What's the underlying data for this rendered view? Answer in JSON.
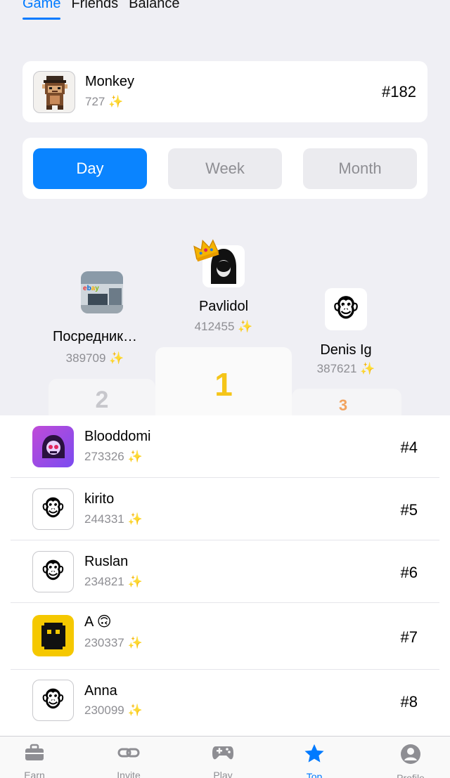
{
  "top_tabs": [
    {
      "label": "Game"
    },
    {
      "label": "Friends"
    },
    {
      "label": "Balance"
    }
  ],
  "me": {
    "name": "Monkey",
    "score": "727",
    "rank": "#182"
  },
  "periods": [
    {
      "label": "Day"
    },
    {
      "label": "Week"
    },
    {
      "label": "Month"
    }
  ],
  "sparkle": "✨",
  "podium": {
    "first": {
      "name": "Pavlidol",
      "score": "412455",
      "place": "1"
    },
    "second": {
      "name": "Посредник…",
      "score": "389709",
      "place": "2"
    },
    "third": {
      "name": "Denis Ig",
      "score": "387621",
      "place": "3"
    }
  },
  "list": [
    {
      "name": "Blooddomi",
      "score": "273326",
      "rank": "#4",
      "avatar": "purple-skull"
    },
    {
      "name": "kirito",
      "score": "244331",
      "rank": "#5",
      "avatar": "monkey-face"
    },
    {
      "name": "Ruslan",
      "score": "234821",
      "rank": "#6",
      "avatar": "monkey-face"
    },
    {
      "name": "A 🙃",
      "score": "230337",
      "rank": "#7",
      "avatar": "yellow-pixel"
    },
    {
      "name": "Anna",
      "score": "230099",
      "rank": "#8",
      "avatar": "monkey-face"
    }
  ],
  "emoji": {
    "monkey": "🐵"
  },
  "nav": [
    {
      "label": "Earn",
      "icon": "briefcase-icon"
    },
    {
      "label": "Invite",
      "icon": "link-icon"
    },
    {
      "label": "Play",
      "icon": "gamepad-icon"
    },
    {
      "label": "Top",
      "icon": "star-icon"
    },
    {
      "label": "Profile",
      "icon": "person-icon"
    }
  ],
  "colors": {
    "accent": "#007aff",
    "gold": "#f5c518",
    "bronze": "#f2a35e",
    "silver": "#c7c7cc"
  }
}
